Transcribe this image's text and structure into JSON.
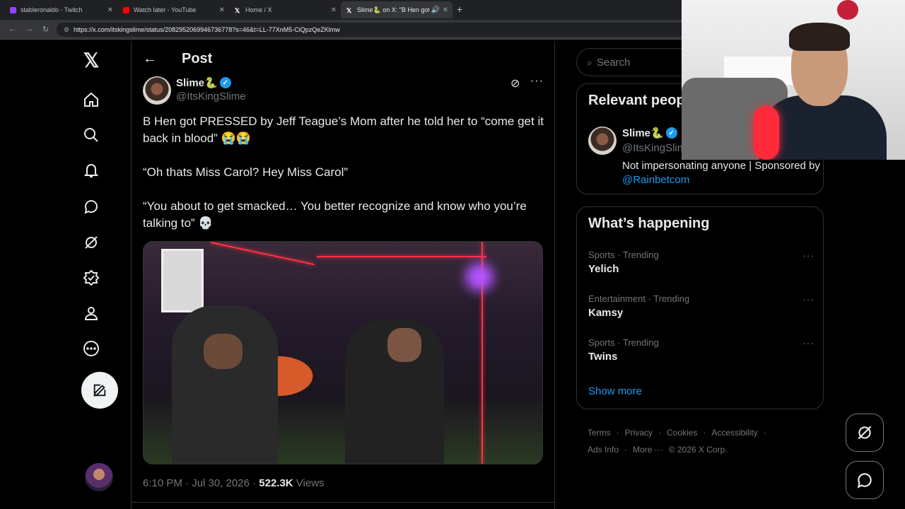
{
  "browser": {
    "tabs": [
      {
        "label": "stableronaldo - Twitch",
        "color": "#9146ff"
      },
      {
        "label": "Watch later - YouTube",
        "color": "#ff0000"
      },
      {
        "label": "Home / X",
        "color": "#ffffff"
      },
      {
        "label": "Slime🐍 on X: \"B Hen got P",
        "color": "#ffffff"
      }
    ],
    "new_tab": "+",
    "url": "https://x.com/itskingslime/status/2082952069946736778?s=46&t=LL-77XnM5-CiQpzQeZKlmw"
  },
  "post": {
    "header_title": "Post",
    "author_name": "Slime🐍",
    "author_handle": "@ItsKingSlime",
    "paragraphs": [
      "B Hen got PRESSED by Jeff Teague’s Mom after he told her to “come get it back in blood” 😭😭",
      "“Oh thats Miss Carol? Hey Miss Carol”",
      "“You about to get smacked… You better recognize and know who you’re talking to” 💀"
    ],
    "time": "6:10 PM · Jul 30, 2026 · ",
    "views_count": "522.3K",
    "views_label": " Views"
  },
  "sidebar": {
    "search_placeholder": "Search",
    "relevant_title": "Relevant people",
    "relevant_name": "Slime🐍",
    "relevant_handle": "@ItsKingSlime",
    "relevant_bio": "Not impersonating anyone | Sponsored by ",
    "relevant_bio_link": "@Rainbetcom",
    "happening_title": "What’s happening",
    "trends": [
      {
        "category": "Sports · Trending",
        "name": "Yelich"
      },
      {
        "category": "Entertainment · Trending",
        "name": "Kamsy"
      },
      {
        "category": "Sports · Trending",
        "name": "Twins"
      }
    ],
    "show_more": "Show more",
    "footer": [
      "Terms",
      "·",
      "Privacy",
      "·",
      "Cookies",
      "·",
      "Accessibility",
      "·",
      "Ads Info",
      "·",
      "More ···",
      "© 2026 X Corp."
    ]
  },
  "colors": {
    "accent": "#1d9bf0",
    "background": "#000000",
    "border": "#2f3336"
  }
}
